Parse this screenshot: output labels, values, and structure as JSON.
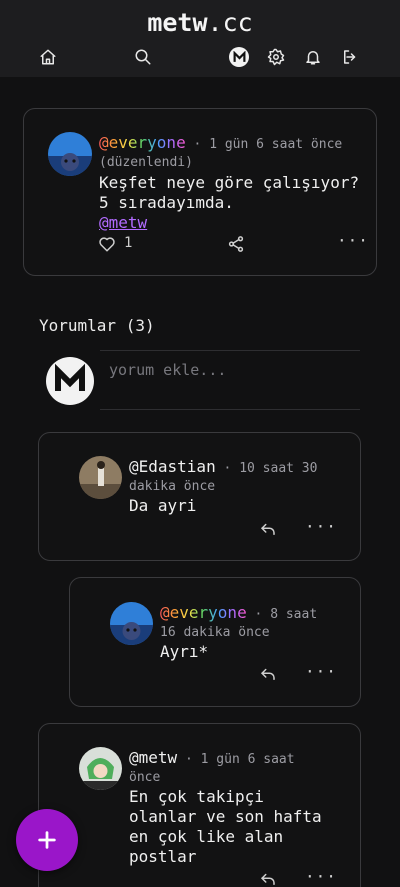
{
  "header": {
    "logo_main": "metw",
    "logo_suffix": ".cc"
  },
  "post": {
    "username": "@everyone",
    "time": "1 gün 6 saat önce",
    "edited": "(düzenlendi)",
    "text_line1": "Keşfet neye göre çalışıyor?",
    "text_line2": "5 sıradayımda.",
    "mention": "@metw",
    "likes": "1"
  },
  "comments_section": {
    "title": "Yorumlar (3)",
    "input_placeholder": "yorum ekle..."
  },
  "comments": [
    {
      "username": "@Edastian",
      "time_line1": "10 saat 30",
      "time_line2": "dakika önce",
      "text": "Da ayri"
    },
    {
      "username": "@everyone",
      "time_line1": "8 saat",
      "time_line2": "16 dakika önce",
      "text": "Ayrı*"
    },
    {
      "username": "@metw",
      "time_line1": "1 gün 6 saat",
      "time_line2": "önce",
      "text_lines": [
        "En çok takipçi",
        "olanlar ve son hafta",
        "en çok like alan",
        "postlar"
      ]
    }
  ],
  "colors": {
    "accent": "#9a16c9",
    "background": "#111112",
    "header": "#1d1d1f",
    "mention": "#b26bff"
  },
  "icons": [
    "home-icon",
    "search-icon",
    "metw-logo-icon",
    "settings-icon",
    "bell-icon",
    "logout-icon",
    "heart-icon",
    "share-icon",
    "reply-icon",
    "more-icon",
    "plus-icon"
  ]
}
